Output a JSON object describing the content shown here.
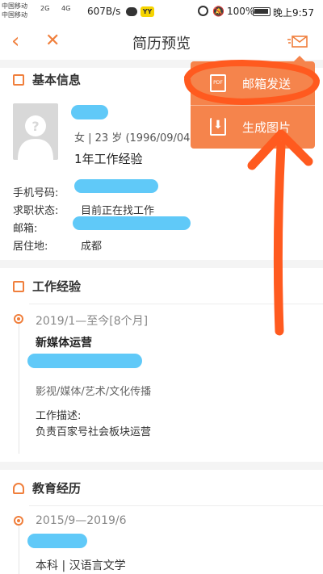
{
  "status_bar": {
    "carrier1": "中国移动",
    "carrier2": "中国移动",
    "signal1": "2G",
    "signal2": "4G",
    "net_speed": "607B/s",
    "yy_label": "YY",
    "battery": "100%",
    "time": "晚上9:57"
  },
  "nav": {
    "back_icon": "‹",
    "close_icon": "✕",
    "title": "简历预览"
  },
  "popup_menu": {
    "items": [
      {
        "label": "邮箱发送",
        "icon": "PDF"
      },
      {
        "label": "生成图片",
        "icon": "⬇"
      }
    ]
  },
  "basic_info": {
    "heading": "基本信息",
    "gender_age": "女 | 23 岁 (1996/09/04)",
    "experience": "1年工作经验",
    "fields": [
      {
        "label": "手机号码:",
        "value": ""
      },
      {
        "label": "求职状态:",
        "value": "目前正在找工作"
      },
      {
        "label": "邮箱:",
        "value": ""
      },
      {
        "label": "居住地:",
        "value": "成都"
      }
    ]
  },
  "work_experience": {
    "heading": "工作经验",
    "entries": [
      {
        "period": "2019/1—至今[8个月]",
        "title": "新媒体运营",
        "company": "",
        "industry": "影视/媒体/艺术/文化传播",
        "desc_label": "工作描述:",
        "desc": "负责百家号社会板块运营"
      }
    ]
  },
  "education": {
    "heading": "教育经历",
    "entries": [
      {
        "period": "2015/9—2019/6",
        "school": "",
        "degree_major": "本科 | 汉语言文学"
      }
    ]
  },
  "colors": {
    "accent": "#f07f3c",
    "popup_bg": "#f5844c",
    "annotation": "#ff5a1f",
    "redaction": "#4fc3f7"
  }
}
